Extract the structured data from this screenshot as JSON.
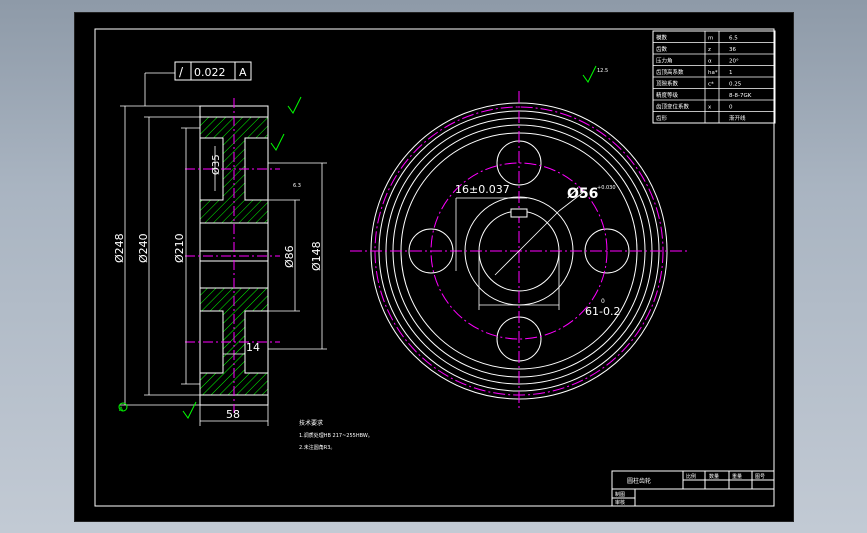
{
  "drawing": {
    "left_view": {
      "geometric_tolerance": {
        "symbol": "/",
        "value": "0.022",
        "datum": "A"
      },
      "dimensions": {
        "d248": "Ø248",
        "d240": "Ø240",
        "d210": "Ø210",
        "d35": "Ø35",
        "d86": "Ø86",
        "d148": "Ø148",
        "width58": "58",
        "web14": "14"
      },
      "roughness_note": "6.3",
      "datum_label": "A"
    },
    "right_view": {
      "keyway_dim": "16±0.037",
      "bore_dim": "Ø56",
      "bore_tol": "+0.030",
      "hub_dim": "61-0.2",
      "hub_dim_tol": "0",
      "roughness_note": "12.5"
    },
    "param_table": {
      "rows": [
        {
          "name": "模数",
          "sym": "m",
          "val": "6.5"
        },
        {
          "name": "齿数",
          "sym": "z",
          "val": "36"
        },
        {
          "name": "压力角",
          "sym": "α",
          "val": "20°"
        },
        {
          "name": "齿顶高系数",
          "sym": "ha*",
          "val": "1"
        },
        {
          "name": "顶隙系数",
          "sym": "c*",
          "val": "0.25"
        },
        {
          "name": "精度等级",
          "sym": "",
          "val": "8-8-7GK"
        },
        {
          "name": "齿顶变位系数",
          "sym": "x",
          "val": "0"
        },
        {
          "name": "齿形",
          "sym": "",
          "val": "渐开线"
        }
      ]
    },
    "tech_req": {
      "title": "技术要求",
      "lines": [
        "1.调质处理HB 217~255HBW。",
        "2.未注圆角R3。"
      ]
    },
    "title_block": {
      "part_name": "圆柱齿轮",
      "headers": [
        "比例",
        "数量",
        "重量",
        "图号"
      ],
      "row1": "制图",
      "row2": "审核"
    }
  }
}
